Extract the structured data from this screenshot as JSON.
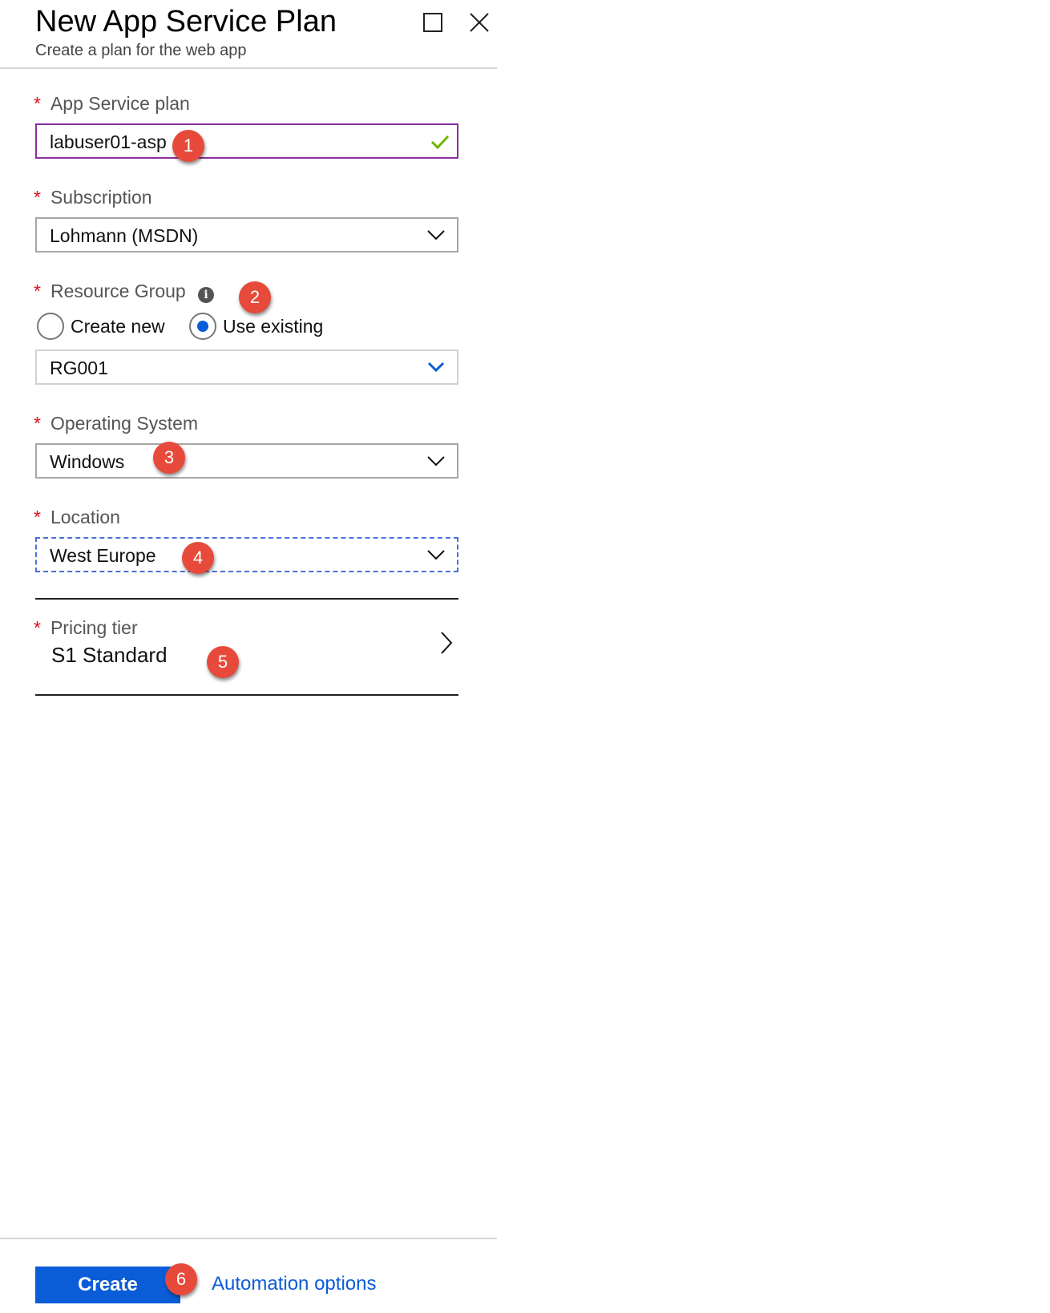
{
  "header": {
    "title": "New App Service Plan",
    "subtitle": "Create a plan for the web app"
  },
  "form": {
    "required_marker": "*",
    "app_service_plan": {
      "label": "App Service plan",
      "value": "labuser01-asp"
    },
    "subscription": {
      "label": "Subscription",
      "value": "Lohmann (MSDN)"
    },
    "resource_group": {
      "label": "Resource Group",
      "info_glyph": "i",
      "option_create_new": "Create new",
      "option_use_existing": "Use existing",
      "selected_option": "Use existing",
      "value": "RG001"
    },
    "operating_system": {
      "label": "Operating System",
      "value": "Windows"
    },
    "location": {
      "label": "Location",
      "value": "West Europe"
    },
    "pricing_tier": {
      "label": "Pricing tier",
      "value": "S1 Standard"
    }
  },
  "annotations": [
    "1",
    "2",
    "3",
    "4",
    "5",
    "6"
  ],
  "footer": {
    "create_label": "Create",
    "automation_label": "Automation options"
  },
  "colors": {
    "accent_blue": "#0b5cd7",
    "required_red": "#e00b1c",
    "badge_red": "#e74a3b",
    "focus_purple": "#8a2d9c",
    "valid_green": "#6bb700"
  }
}
